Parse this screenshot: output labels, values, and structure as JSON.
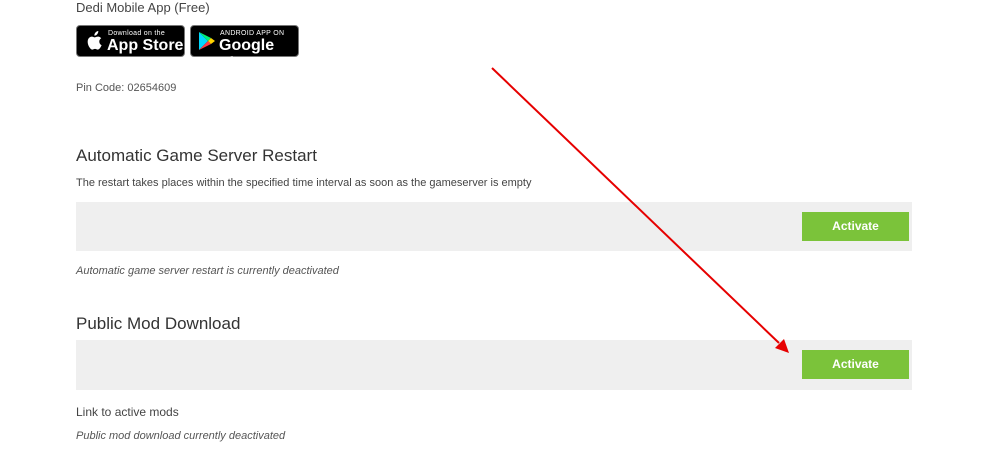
{
  "apps": {
    "title": "Dedi Mobile App (Free)",
    "appstore": {
      "small": "Download on the",
      "big": "App Store"
    },
    "googleplay": {
      "small": "ANDROID APP ON",
      "big": "Google Play"
    },
    "pin_code": "Pin Code: 02654609"
  },
  "restart": {
    "title": "Automatic Game Server Restart",
    "description": "The restart takes places within the specified time interval as soon as the gameserver is empty",
    "button": "Activate",
    "status": "Automatic game server restart is currently deactivated"
  },
  "mod_download": {
    "title": "Public Mod Download",
    "button": "Activate",
    "link": "Link to active mods",
    "status": "Public mod download currently deactivated"
  },
  "colors": {
    "button_bg": "#7bc33a",
    "panel_bg": "#efefef",
    "arrow": "#e60000"
  }
}
